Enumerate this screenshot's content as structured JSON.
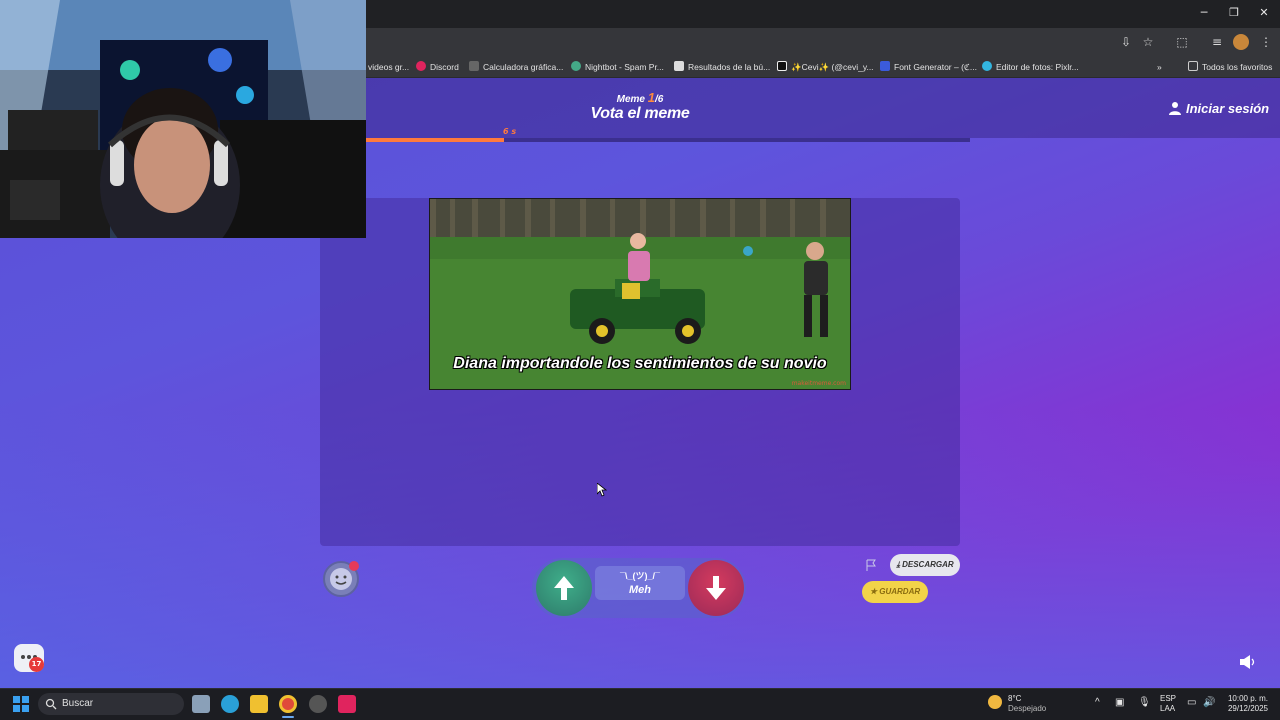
{
  "browser": {
    "window_controls": {
      "minimize": "─",
      "restore": "❐",
      "close": "✕"
    },
    "bookmarks": [
      {
        "label": "videos gr...",
        "color": "#888"
      },
      {
        "label": "Discord",
        "color": "#e0245e"
      },
      {
        "label": "Calculadora gráfica...",
        "color": "#777"
      },
      {
        "label": "Nightbot - Spam Pr...",
        "color": "#4a8"
      },
      {
        "label": "Resultados de la bú...",
        "color": "#ddd"
      },
      {
        "label": "✨Cevi✨ (@cevi_y...",
        "color": "#111"
      },
      {
        "label": "Font Generator – (ℭ...",
        "color": "#3b5bdb"
      },
      {
        "label": "Editor de fotos: Pixlr...",
        "color": "#33b6e0"
      }
    ],
    "all_bookmarks": "Todos los favoritos"
  },
  "header": {
    "counter_prefix": "Meme",
    "counter_current": "1",
    "counter_total": "/6",
    "title": "Vota el meme",
    "login": "Iniciar sesión",
    "timer": "6 s",
    "progress": 0.52
  },
  "meme": {
    "caption": "Diana importandole los sentimientos de su novio",
    "watermark": "makeitmeme.com"
  },
  "vote": {
    "meh_face": "¯\\_(ツ)_/¯",
    "meh_label": "Meh",
    "up_color": "#3fae8a",
    "down_color": "#d43a5e"
  },
  "actions": {
    "download": "DESCARGAR",
    "save": "GUARDAR"
  },
  "chat": {
    "badge": "17"
  },
  "taskbar": {
    "search_placeholder": "Buscar",
    "weather_temp": "8°C",
    "weather_desc": "Despejado",
    "lang_1": "ESP",
    "lang_2": "LAA",
    "time": "10:00 p. m.",
    "date": "29/12/2025"
  },
  "colors": {
    "accent_orange": "#ff7a3d",
    "bg_purple": "#8a2fd2",
    "bg_blue": "#5b4fd6"
  }
}
